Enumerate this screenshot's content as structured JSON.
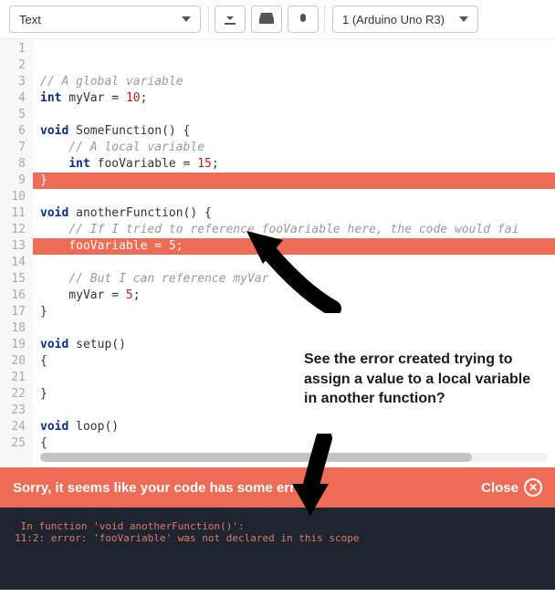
{
  "toolbar": {
    "mode_label": "Text",
    "board_label": "1 (Arduino Uno R3)"
  },
  "code": {
    "lines": [
      {
        "n": 1,
        "hl": false,
        "seg": [
          [
            "com",
            "// A global variable"
          ]
        ]
      },
      {
        "n": 2,
        "hl": false,
        "seg": [
          [
            "typ",
            "int"
          ],
          [
            "txt",
            " myVar = "
          ],
          [
            "num",
            "10"
          ],
          [
            "txt",
            ";"
          ]
        ]
      },
      {
        "n": 3,
        "hl": false,
        "seg": []
      },
      {
        "n": 4,
        "hl": false,
        "seg": [
          [
            "kw",
            "void"
          ],
          [
            "txt",
            " "
          ],
          [
            "fn",
            "SomeFunction"
          ],
          [
            "txt",
            "() {"
          ]
        ]
      },
      {
        "n": 5,
        "hl": false,
        "seg": [
          [
            "txt",
            "    "
          ],
          [
            "com",
            "// A local variable"
          ]
        ]
      },
      {
        "n": 6,
        "hl": false,
        "seg": [
          [
            "txt",
            "    "
          ],
          [
            "typ",
            "int"
          ],
          [
            "txt",
            " fooVariable = "
          ],
          [
            "num",
            "15"
          ],
          [
            "txt",
            ";"
          ]
        ]
      },
      {
        "n": 7,
        "hl": true,
        "seg": [
          [
            "txt",
            "}"
          ]
        ]
      },
      {
        "n": 8,
        "hl": false,
        "seg": []
      },
      {
        "n": 9,
        "hl": false,
        "seg": [
          [
            "kw",
            "void"
          ],
          [
            "txt",
            " "
          ],
          [
            "fn",
            "anotherFunction"
          ],
          [
            "txt",
            "() {"
          ]
        ]
      },
      {
        "n": 10,
        "hl": false,
        "seg": [
          [
            "txt",
            "    "
          ],
          [
            "com",
            "// If I tried to reference fooVariable here, the code would fai"
          ]
        ]
      },
      {
        "n": 11,
        "hl": true,
        "seg": [
          [
            "txt",
            "    fooVariable = "
          ],
          [
            "num",
            "5"
          ],
          [
            "txt",
            ";"
          ]
        ]
      },
      {
        "n": 12,
        "hl": false,
        "seg": []
      },
      {
        "n": 13,
        "hl": false,
        "seg": [
          [
            "txt",
            "    "
          ],
          [
            "com",
            "// But I can reference myVar"
          ]
        ]
      },
      {
        "n": 14,
        "hl": false,
        "seg": [
          [
            "txt",
            "    myVar = "
          ],
          [
            "num",
            "5"
          ],
          [
            "txt",
            ";"
          ]
        ]
      },
      {
        "n": 15,
        "hl": false,
        "seg": [
          [
            "txt",
            "}"
          ]
        ]
      },
      {
        "n": 16,
        "hl": false,
        "seg": []
      },
      {
        "n": 17,
        "hl": false,
        "seg": [
          [
            "kw",
            "void"
          ],
          [
            "txt",
            " "
          ],
          [
            "fn",
            "setup"
          ],
          [
            "txt",
            "()"
          ]
        ]
      },
      {
        "n": 18,
        "hl": false,
        "seg": [
          [
            "txt",
            "{"
          ]
        ]
      },
      {
        "n": 19,
        "hl": false,
        "seg": []
      },
      {
        "n": 20,
        "hl": false,
        "seg": [
          [
            "txt",
            "}"
          ]
        ]
      },
      {
        "n": 21,
        "hl": false,
        "seg": []
      },
      {
        "n": 22,
        "hl": false,
        "seg": [
          [
            "kw",
            "void"
          ],
          [
            "txt",
            " "
          ],
          [
            "fn",
            "loop"
          ],
          [
            "txt",
            "()"
          ]
        ]
      },
      {
        "n": 23,
        "hl": false,
        "seg": [
          [
            "txt",
            "{"
          ]
        ]
      },
      {
        "n": 24,
        "hl": false,
        "seg": []
      },
      {
        "n": 25,
        "hl": false,
        "seg": [
          [
            "txt",
            "}"
          ]
        ]
      }
    ]
  },
  "annotation": {
    "text": "See the error created trying to assign a value to a local variable in another function?"
  },
  "error_banner": {
    "message": "Sorry, it seems like your code has some errors.",
    "close_label": "Close"
  },
  "console": {
    "text": " In function 'void anotherFunction()':\n11:2: error: 'fooVariable' was not declared in this scope"
  }
}
